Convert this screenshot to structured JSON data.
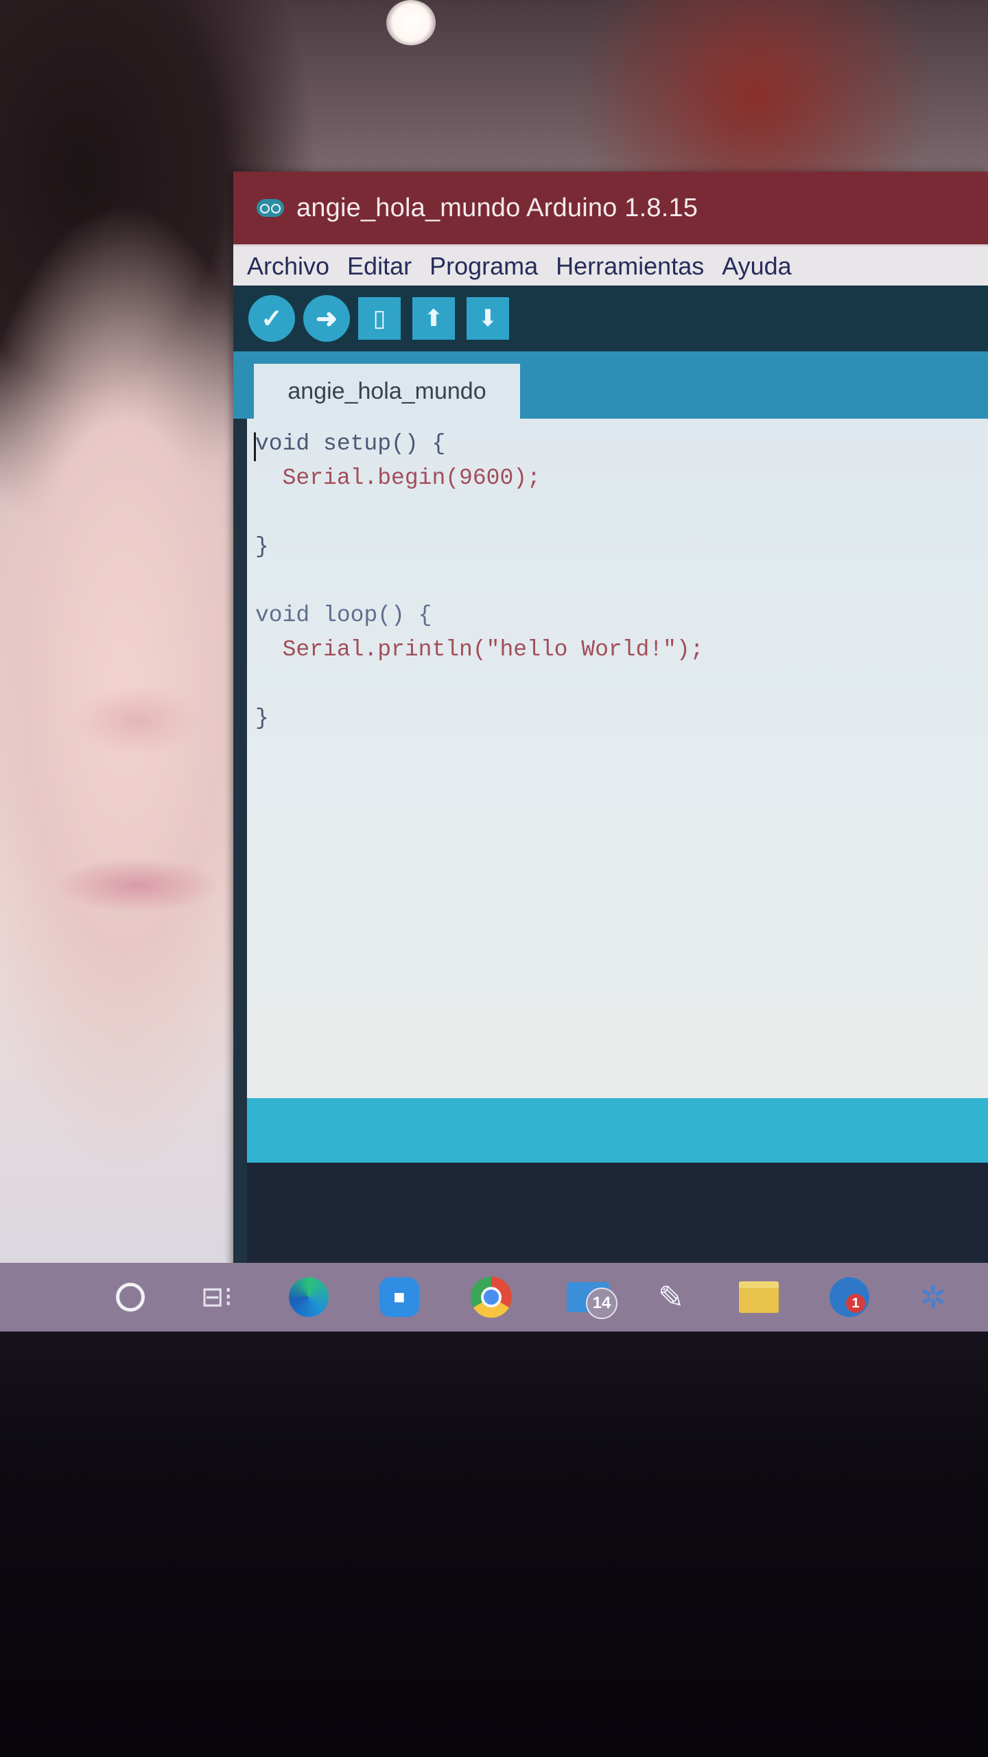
{
  "window": {
    "title": "angie_hola_mundo Arduino 1.8.15"
  },
  "menu": {
    "items": [
      "Archivo",
      "Editar",
      "Programa",
      "Herramientas",
      "Ayuda"
    ]
  },
  "toolbar": {
    "buttons": [
      {
        "icon": "verify-check-icon",
        "glyph": "✓"
      },
      {
        "icon": "upload-arrow-icon",
        "glyph": "➜"
      },
      {
        "icon": "new-file-icon",
        "glyph": "▯"
      },
      {
        "icon": "open-arrow-up-icon",
        "glyph": "⬆"
      },
      {
        "icon": "save-arrow-down-icon",
        "glyph": "⬇"
      }
    ]
  },
  "tab": {
    "label": "angie_hola_mundo"
  },
  "code": {
    "lines": [
      "void setup() {",
      "  Serial.begin(9600);",
      "",
      "}",
      "",
      "void loop() {",
      "  Serial.println(\"hello World!\");",
      "",
      "}"
    ]
  },
  "taskbar": {
    "mail_badge": "14",
    "arduino_badge": "1",
    "task_view_glyph": "⊟⁝",
    "paint_glyph": "✎",
    "people_glyph": "✲"
  },
  "colors": {
    "title_bar": "#7a2a35",
    "toolbar": "#173747",
    "accent": "#2fa4c8",
    "status_bar": "#32b4d1"
  }
}
